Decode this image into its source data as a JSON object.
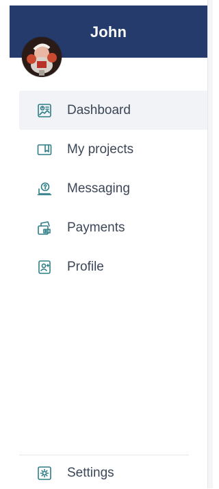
{
  "user": {
    "name": "John"
  },
  "nav": {
    "items": [
      {
        "label": "Dashboard",
        "icon": "dashboard-icon",
        "active": true
      },
      {
        "label": "My projects",
        "icon": "projects-icon",
        "active": false
      },
      {
        "label": "Messaging",
        "icon": "messaging-icon",
        "active": false
      },
      {
        "label": "Payments",
        "icon": "payments-icon",
        "active": false
      },
      {
        "label": "Profile",
        "icon": "profile-icon",
        "active": false
      }
    ]
  },
  "footer": {
    "settings_label": "Settings",
    "settings_icon": "settings-icon"
  },
  "colors": {
    "header": "#243b6b",
    "icon": "#2d7d86",
    "text": "#3b4656",
    "active_bg": "#f1f3f6"
  }
}
